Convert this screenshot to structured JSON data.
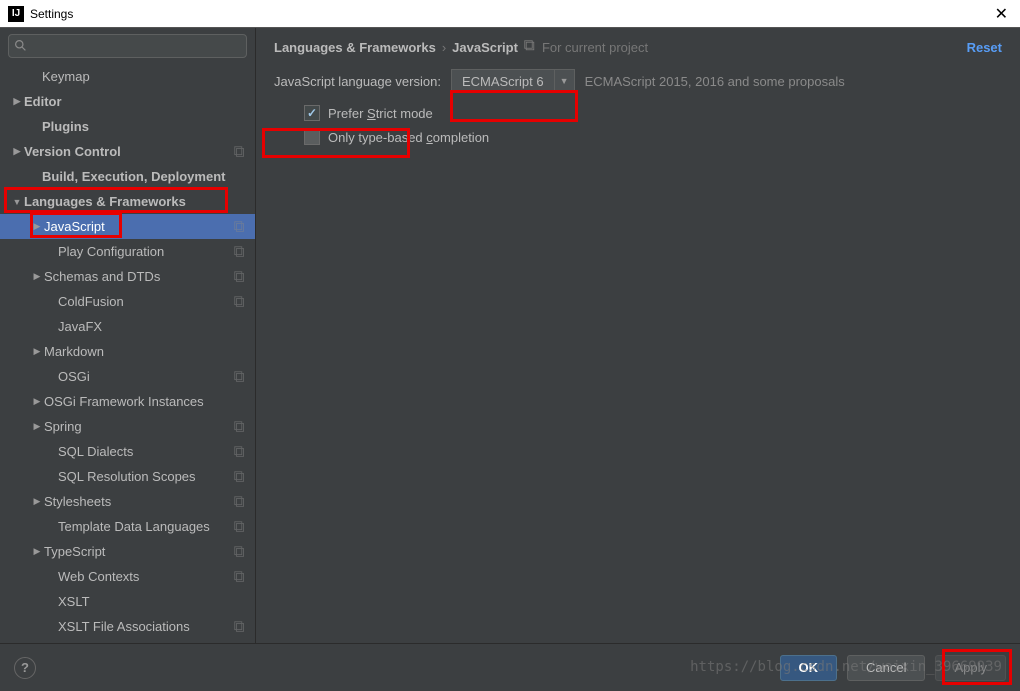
{
  "window": {
    "title": "Settings"
  },
  "search": {
    "placeholder": ""
  },
  "sidebar": {
    "items": [
      {
        "label": "Keymap",
        "indent": 28,
        "bold": false,
        "arrow": "",
        "copy": false
      },
      {
        "label": "Editor",
        "indent": 10,
        "bold": true,
        "arrow": "▶",
        "copy": false
      },
      {
        "label": "Plugins",
        "indent": 28,
        "bold": true,
        "arrow": "",
        "copy": false
      },
      {
        "label": "Version Control",
        "indent": 10,
        "bold": true,
        "arrow": "▶",
        "copy": true
      },
      {
        "label": "Build, Execution, Deployment",
        "indent": 28,
        "bold": true,
        "arrow": "",
        "copy": false
      },
      {
        "label": "Languages & Frameworks",
        "indent": 10,
        "bold": true,
        "arrow": "▼",
        "copy": false
      },
      {
        "label": "JavaScript",
        "indent": 30,
        "bold": false,
        "arrow": "▶",
        "copy": true,
        "selected": true
      },
      {
        "label": "Play Configuration",
        "indent": 44,
        "bold": false,
        "arrow": "",
        "copy": true
      },
      {
        "label": "Schemas and DTDs",
        "indent": 30,
        "bold": false,
        "arrow": "▶",
        "copy": true
      },
      {
        "label": "ColdFusion",
        "indent": 44,
        "bold": false,
        "arrow": "",
        "copy": true
      },
      {
        "label": "JavaFX",
        "indent": 44,
        "bold": false,
        "arrow": "",
        "copy": false
      },
      {
        "label": "Markdown",
        "indent": 30,
        "bold": false,
        "arrow": "▶",
        "copy": false
      },
      {
        "label": "OSGi",
        "indent": 44,
        "bold": false,
        "arrow": "",
        "copy": true
      },
      {
        "label": "OSGi Framework Instances",
        "indent": 30,
        "bold": false,
        "arrow": "▶",
        "copy": false
      },
      {
        "label": "Spring",
        "indent": 30,
        "bold": false,
        "arrow": "▶",
        "copy": true
      },
      {
        "label": "SQL Dialects",
        "indent": 44,
        "bold": false,
        "arrow": "",
        "copy": true
      },
      {
        "label": "SQL Resolution Scopes",
        "indent": 44,
        "bold": false,
        "arrow": "",
        "copy": true
      },
      {
        "label": "Stylesheets",
        "indent": 30,
        "bold": false,
        "arrow": "▶",
        "copy": true
      },
      {
        "label": "Template Data Languages",
        "indent": 44,
        "bold": false,
        "arrow": "",
        "copy": true
      },
      {
        "label": "TypeScript",
        "indent": 30,
        "bold": false,
        "arrow": "▶",
        "copy": true
      },
      {
        "label": "Web Contexts",
        "indent": 44,
        "bold": false,
        "arrow": "",
        "copy": true
      },
      {
        "label": "XSLT",
        "indent": 44,
        "bold": false,
        "arrow": "",
        "copy": false
      },
      {
        "label": "XSLT File Associations",
        "indent": 44,
        "bold": false,
        "arrow": "",
        "copy": true
      }
    ]
  },
  "breadcrumb": {
    "part1": "Languages & Frameworks",
    "part2": "JavaScript",
    "project": "For current project"
  },
  "content": {
    "reset": "Reset",
    "langVersionLabel": "JavaScript language version:",
    "langVersionValue": "ECMAScript 6",
    "langVersionDesc": "ECMAScript 2015, 2016 and some proposals",
    "preferStrictPrefix": "Prefer ",
    "preferStrictU": "S",
    "preferStrictSuffix": "trict mode",
    "onlyTypePrefix": "Only type-based ",
    "onlyTypeU": "c",
    "onlyTypeSuffix": "ompletion"
  },
  "footer": {
    "ok": "OK",
    "cancel": "Cancel",
    "apply": "Apply"
  },
  "watermark": "https://blog.csdn.net/weixin_39669939"
}
